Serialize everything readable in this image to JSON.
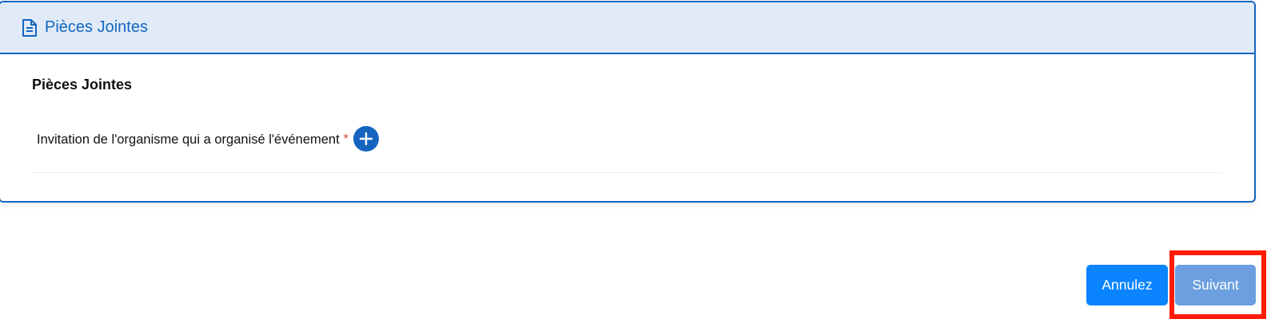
{
  "header": {
    "title": "Pièces Jointes",
    "icon": "document-icon"
  },
  "section": {
    "title": "Pièces Jointes"
  },
  "attachment": {
    "label": "Invitation de l'organisme qui a organisé l'événement",
    "required_marker": "*",
    "add_icon": "plus-circle-icon"
  },
  "actions": {
    "cancel_label": "Annulez",
    "next_label": "Suivant"
  },
  "colors": {
    "primary": "#1565c0",
    "header_bg": "#e0ebf7",
    "cancel": "#0a84ff",
    "next_disabled": "#6b9fe0",
    "required": "#e53935",
    "highlight": "#ff1a00"
  }
}
